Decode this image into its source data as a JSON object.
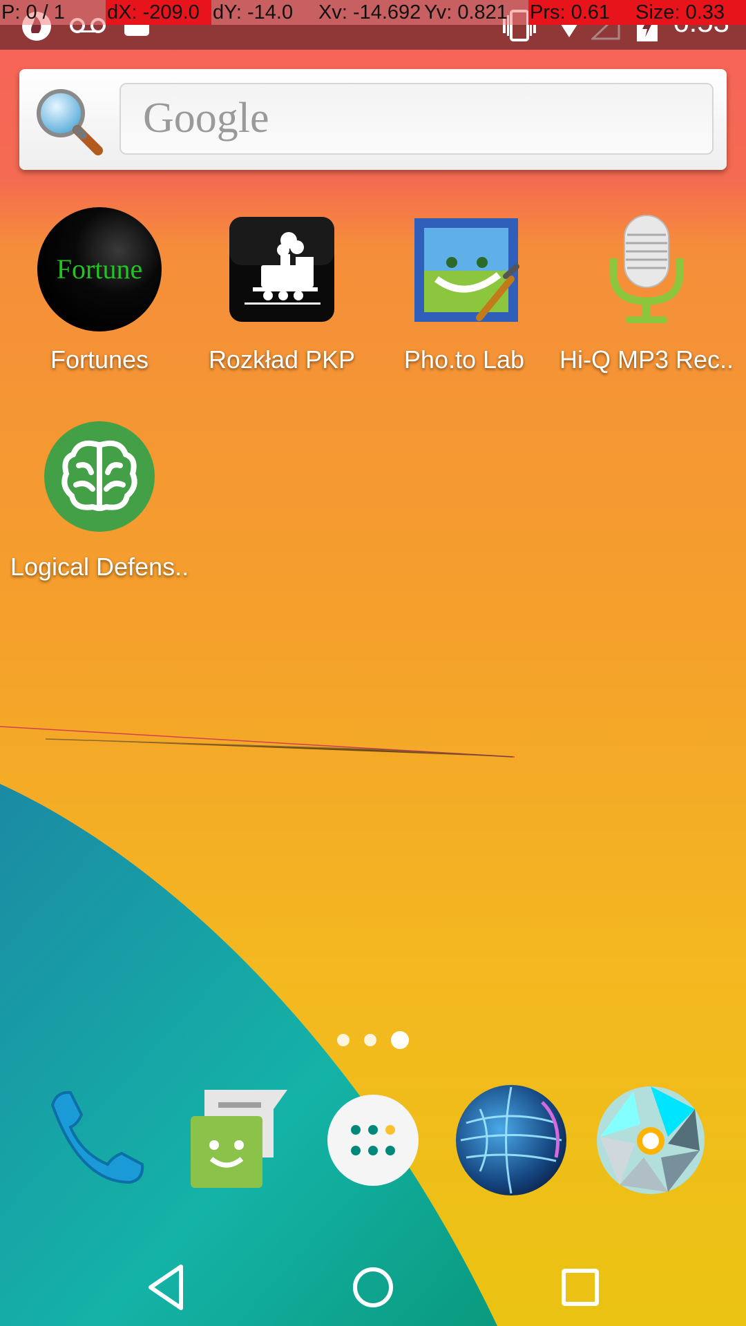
{
  "debug_overlay": {
    "pointer": "P: 0 / 1",
    "dx": "dX: -209.0",
    "dy": "dY: -14.0",
    "xv": "Xv: -14.692",
    "yv": "Yv: 0.821",
    "pressure": "Prs: 0.61",
    "size": "Size: 0.33"
  },
  "status_bar": {
    "time": "6:53",
    "icons": [
      "alert-flame-icon",
      "voicemail-icon",
      "briefcase-icon",
      "vibrate-icon",
      "wifi-icon",
      "no-signal-icon",
      "battery-charging-icon"
    ]
  },
  "search_widget": {
    "placeholder": "Google",
    "icon": "search-icon"
  },
  "apps": [
    {
      "label": "Fortunes",
      "icon": "fortune-icon",
      "icon_text": "Fortune"
    },
    {
      "label": "Rozkład PKP",
      "icon": "train-icon"
    },
    {
      "label": "Pho.to Lab",
      "icon": "photo-lab-icon"
    },
    {
      "label": "Hi-Q MP3 Rec..",
      "icon": "microphone-icon"
    },
    {
      "label": "Logical Defens..",
      "icon": "brain-icon"
    }
  ],
  "page_indicator": {
    "pages": 3,
    "current": 3
  },
  "dock": [
    "phone-icon",
    "messaging-icon",
    "app-drawer-icon",
    "browser-globe-icon",
    "camera-icon"
  ],
  "nav_bar": [
    "back-icon",
    "home-icon",
    "recents-icon"
  ],
  "colors": {
    "wallpaper_top": "#f6625a",
    "wallpaper_mid": "#f5a02c",
    "wallpaper_bottom": "#eac312",
    "wallpaper_teal": "#17a7a0",
    "debug_red": "#e8141b"
  }
}
